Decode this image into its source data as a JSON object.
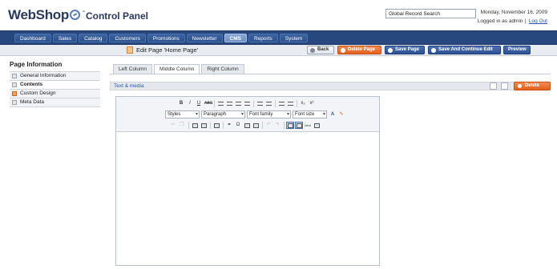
{
  "header": {
    "logo_name": "WebShop",
    "logo_tm": "™",
    "logo_sub": "Control Panel",
    "global_search_value": "Global Record Search",
    "date": "Monday, November 16, 2009",
    "login_text": "Logged in as admin",
    "logout_label": "Log Out"
  },
  "nav": {
    "items": [
      "Dashboard",
      "Sales",
      "Catalog",
      "Customers",
      "Promotions",
      "Newsletter",
      "CMS",
      "Reports",
      "System"
    ],
    "active": "CMS"
  },
  "toolbar": {
    "page_title": "Edit Page 'Home Page'",
    "back_label": "Back",
    "delete_label": "Delete Page",
    "save_label": "Save Page",
    "save_continue_label": "Save And Continue Edit",
    "preview_label": "Preview"
  },
  "sidebar": {
    "title": "Page Information",
    "items": [
      "General Information",
      "Contents",
      "Custom Design",
      "Meta Data"
    ],
    "active": "Contents"
  },
  "tabs": {
    "items": [
      "Left Column",
      "Middle Column",
      "Right Column"
    ],
    "active": "Middle Column"
  },
  "section": {
    "title": "Text & media",
    "delete_label": "Delete"
  },
  "editor": {
    "row1": [
      "B",
      "I",
      "U",
      "ABC"
    ],
    "row1b": [
      "x₂",
      "x²"
    ],
    "selects": [
      "Styles",
      "Paragraph",
      "Font family",
      "Font size"
    ],
    "row3": [
      "Ω"
    ],
    "colors": {
      "nav_bg": "#26487f",
      "orange": "#e2611f",
      "blue_btn": "#2c4f92"
    }
  }
}
